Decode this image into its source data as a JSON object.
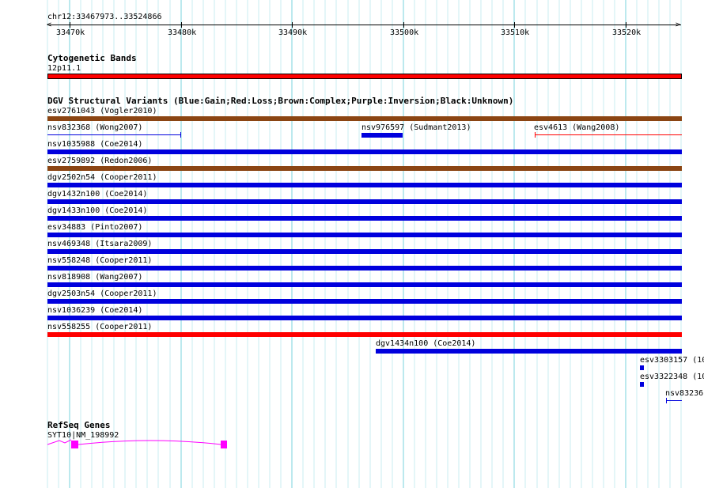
{
  "ruler": {
    "location_label": "chr12:33467973..33524866",
    "ticks": [
      "33470k",
      "33480k",
      "33490k",
      "33500k",
      "33510k",
      "33520k"
    ]
  },
  "tracks": {
    "cytoband": {
      "title": "Cytogenetic Bands",
      "band_label": "12p11.1"
    },
    "dgv": {
      "title": "DGV Structural Variants (Blue:Gain;Red:Loss;Brown:Complex;Purple:Inversion;Black:Unknown)",
      "features": [
        {
          "label": "esv2761043 (Vogler2010)",
          "type": "Complex"
        },
        {
          "label": "nsv832368 (Wong2007)",
          "type": "Gain"
        },
        {
          "label": "nsv976597 (Sudmant2013)",
          "type": "Gain"
        },
        {
          "label": "esv4613 (Wang2008)",
          "type": "Loss"
        },
        {
          "label": "nsv1035988 (Coe2014)",
          "type": "Gain"
        },
        {
          "label": "esv2759892 (Redon2006)",
          "type": "Complex"
        },
        {
          "label": "dgv2502n54 (Cooper2011)",
          "type": "Gain"
        },
        {
          "label": "dgv1432n100 (Coe2014)",
          "type": "Gain"
        },
        {
          "label": "dgv1433n100 (Coe2014)",
          "type": "Gain"
        },
        {
          "label": "esv34883 (Pinto2007)",
          "type": "Gain"
        },
        {
          "label": "nsv469348 (Itsara2009)",
          "type": "Gain"
        },
        {
          "label": "nsv558248 (Cooper2011)",
          "type": "Gain"
        },
        {
          "label": "nsv818908 (Wang2007)",
          "type": "Gain"
        },
        {
          "label": "dgv2503n54 (Cooper2011)",
          "type": "Gain"
        },
        {
          "label": "nsv1036239 (Coe2014)",
          "type": "Gain"
        },
        {
          "label": "nsv558255 (Cooper2011)",
          "type": "Loss"
        },
        {
          "label": "dgv1434n100 (Coe2014)",
          "type": "Gain"
        },
        {
          "label": "esv3303157 (10",
          "type": "Gain"
        },
        {
          "label": "esv3322348 (10",
          "type": "Gain"
        },
        {
          "label": "nsv83236",
          "type": "Gain"
        }
      ]
    },
    "refseq": {
      "title": "RefSeq Genes",
      "gene_label": "SYT10|NM_198992"
    }
  },
  "colors": {
    "grid_major": "#7ad3dc",
    "grid_minor": "#c8ecf0",
    "gain": "#0000dd",
    "loss": "#ff0000",
    "complex": "#8b4513",
    "cytoband": "#ff0000",
    "gene": "#ff00ff"
  }
}
